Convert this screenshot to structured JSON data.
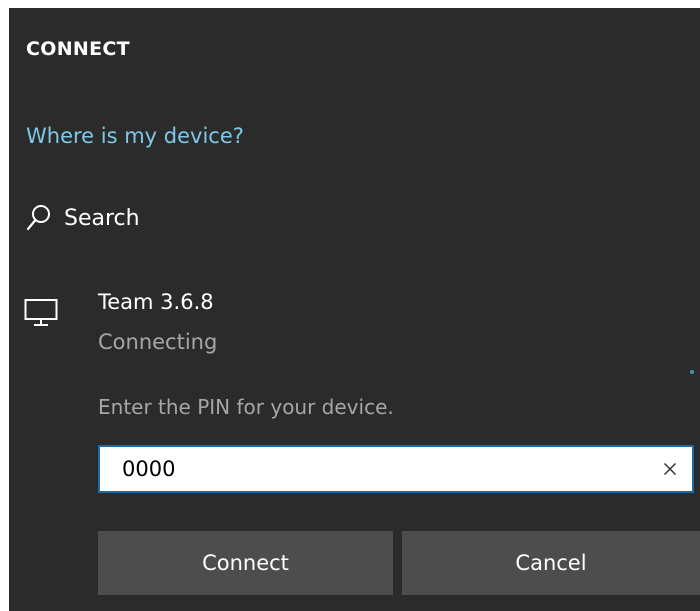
{
  "panel": {
    "title": "CONNECT",
    "help_link": "Where is my device?",
    "search_label": "Search"
  },
  "device": {
    "name": "Team 3.6.8",
    "status": "Connecting",
    "icon": "monitor-icon"
  },
  "pin": {
    "prompt": "Enter the PIN for your device.",
    "value": "0000",
    "clear_icon": "close-icon"
  },
  "buttons": {
    "connect": "Connect",
    "cancel": "Cancel"
  },
  "colors": {
    "background": "#2b2b2b",
    "link": "#7fc7e8",
    "secondary_text": "#a6a6a6",
    "input_border": "#1f6aa5",
    "button": "#4d4d4d"
  }
}
